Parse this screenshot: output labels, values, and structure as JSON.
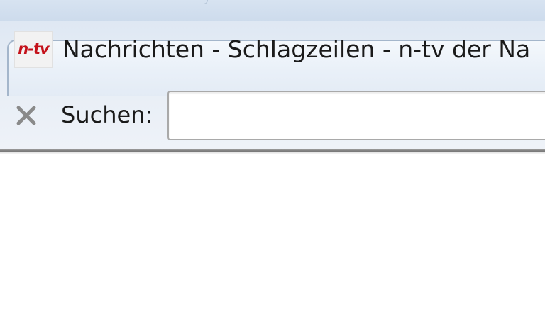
{
  "tab": {
    "favicon_label": "n-tv",
    "title": "Nachrichten - Schlagzeilen - n-tv der Na"
  },
  "findbar": {
    "close_icon": "close-icon",
    "label": "Suchen:",
    "input_value": "",
    "input_placeholder": ""
  },
  "colors": {
    "favicon_brand": "#c4121a",
    "chrome_background": "#e3ebf5",
    "tab_border": "#a4b6cb"
  }
}
